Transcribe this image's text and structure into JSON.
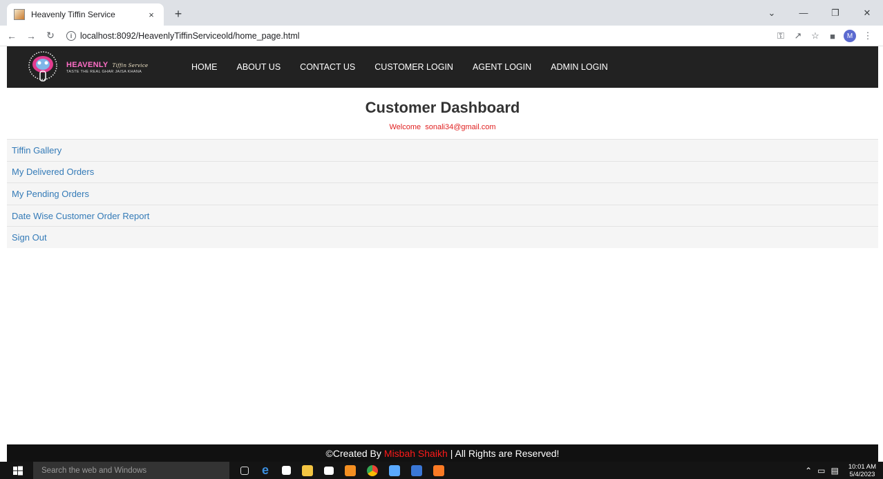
{
  "browser": {
    "tab_title": "Heavenly Tiffin Service",
    "tab_close": "×",
    "new_tab": "+",
    "url": "localhost:8092/HeavenlyTiffinServiceold/home_page.html",
    "profile_initial": "M"
  },
  "site": {
    "brand_name": "HEAVENLY",
    "brand_script": "Tiffin Service",
    "tagline": "TASTE THE REAL GHAR JAISA KHANA",
    "nav": [
      {
        "label": "HOME"
      },
      {
        "label": "ABOUT US"
      },
      {
        "label": "CONTACT US"
      },
      {
        "label": "CUSTOMER LOGIN"
      },
      {
        "label": "AGENT LOGIN"
      },
      {
        "label": "ADMIN LOGIN"
      }
    ]
  },
  "dashboard": {
    "title": "Customer Dashboard",
    "welcome_prefix": "Welcome",
    "user_email": "sonali34@gmail.com",
    "menu": [
      {
        "label": "Tiffin Gallery"
      },
      {
        "label": "My Delivered Orders"
      },
      {
        "label": "My Pending Orders"
      },
      {
        "label": "Date Wise Customer Order Report"
      },
      {
        "label": "Sign Out"
      }
    ]
  },
  "footer": {
    "prefix": "©Created By",
    "author": "Misbah Shaikh",
    "suffix": "| All Rights are Reserved!"
  },
  "taskbar": {
    "search_placeholder": "Search the web and Windows",
    "time": "10:01 AM",
    "date": "5/4/2023"
  },
  "colors": {
    "header_bg": "#222222",
    "link": "#337ab7",
    "welcome": "#e02020",
    "author": "#ff1a1a",
    "brand": "#ff6ec7"
  }
}
